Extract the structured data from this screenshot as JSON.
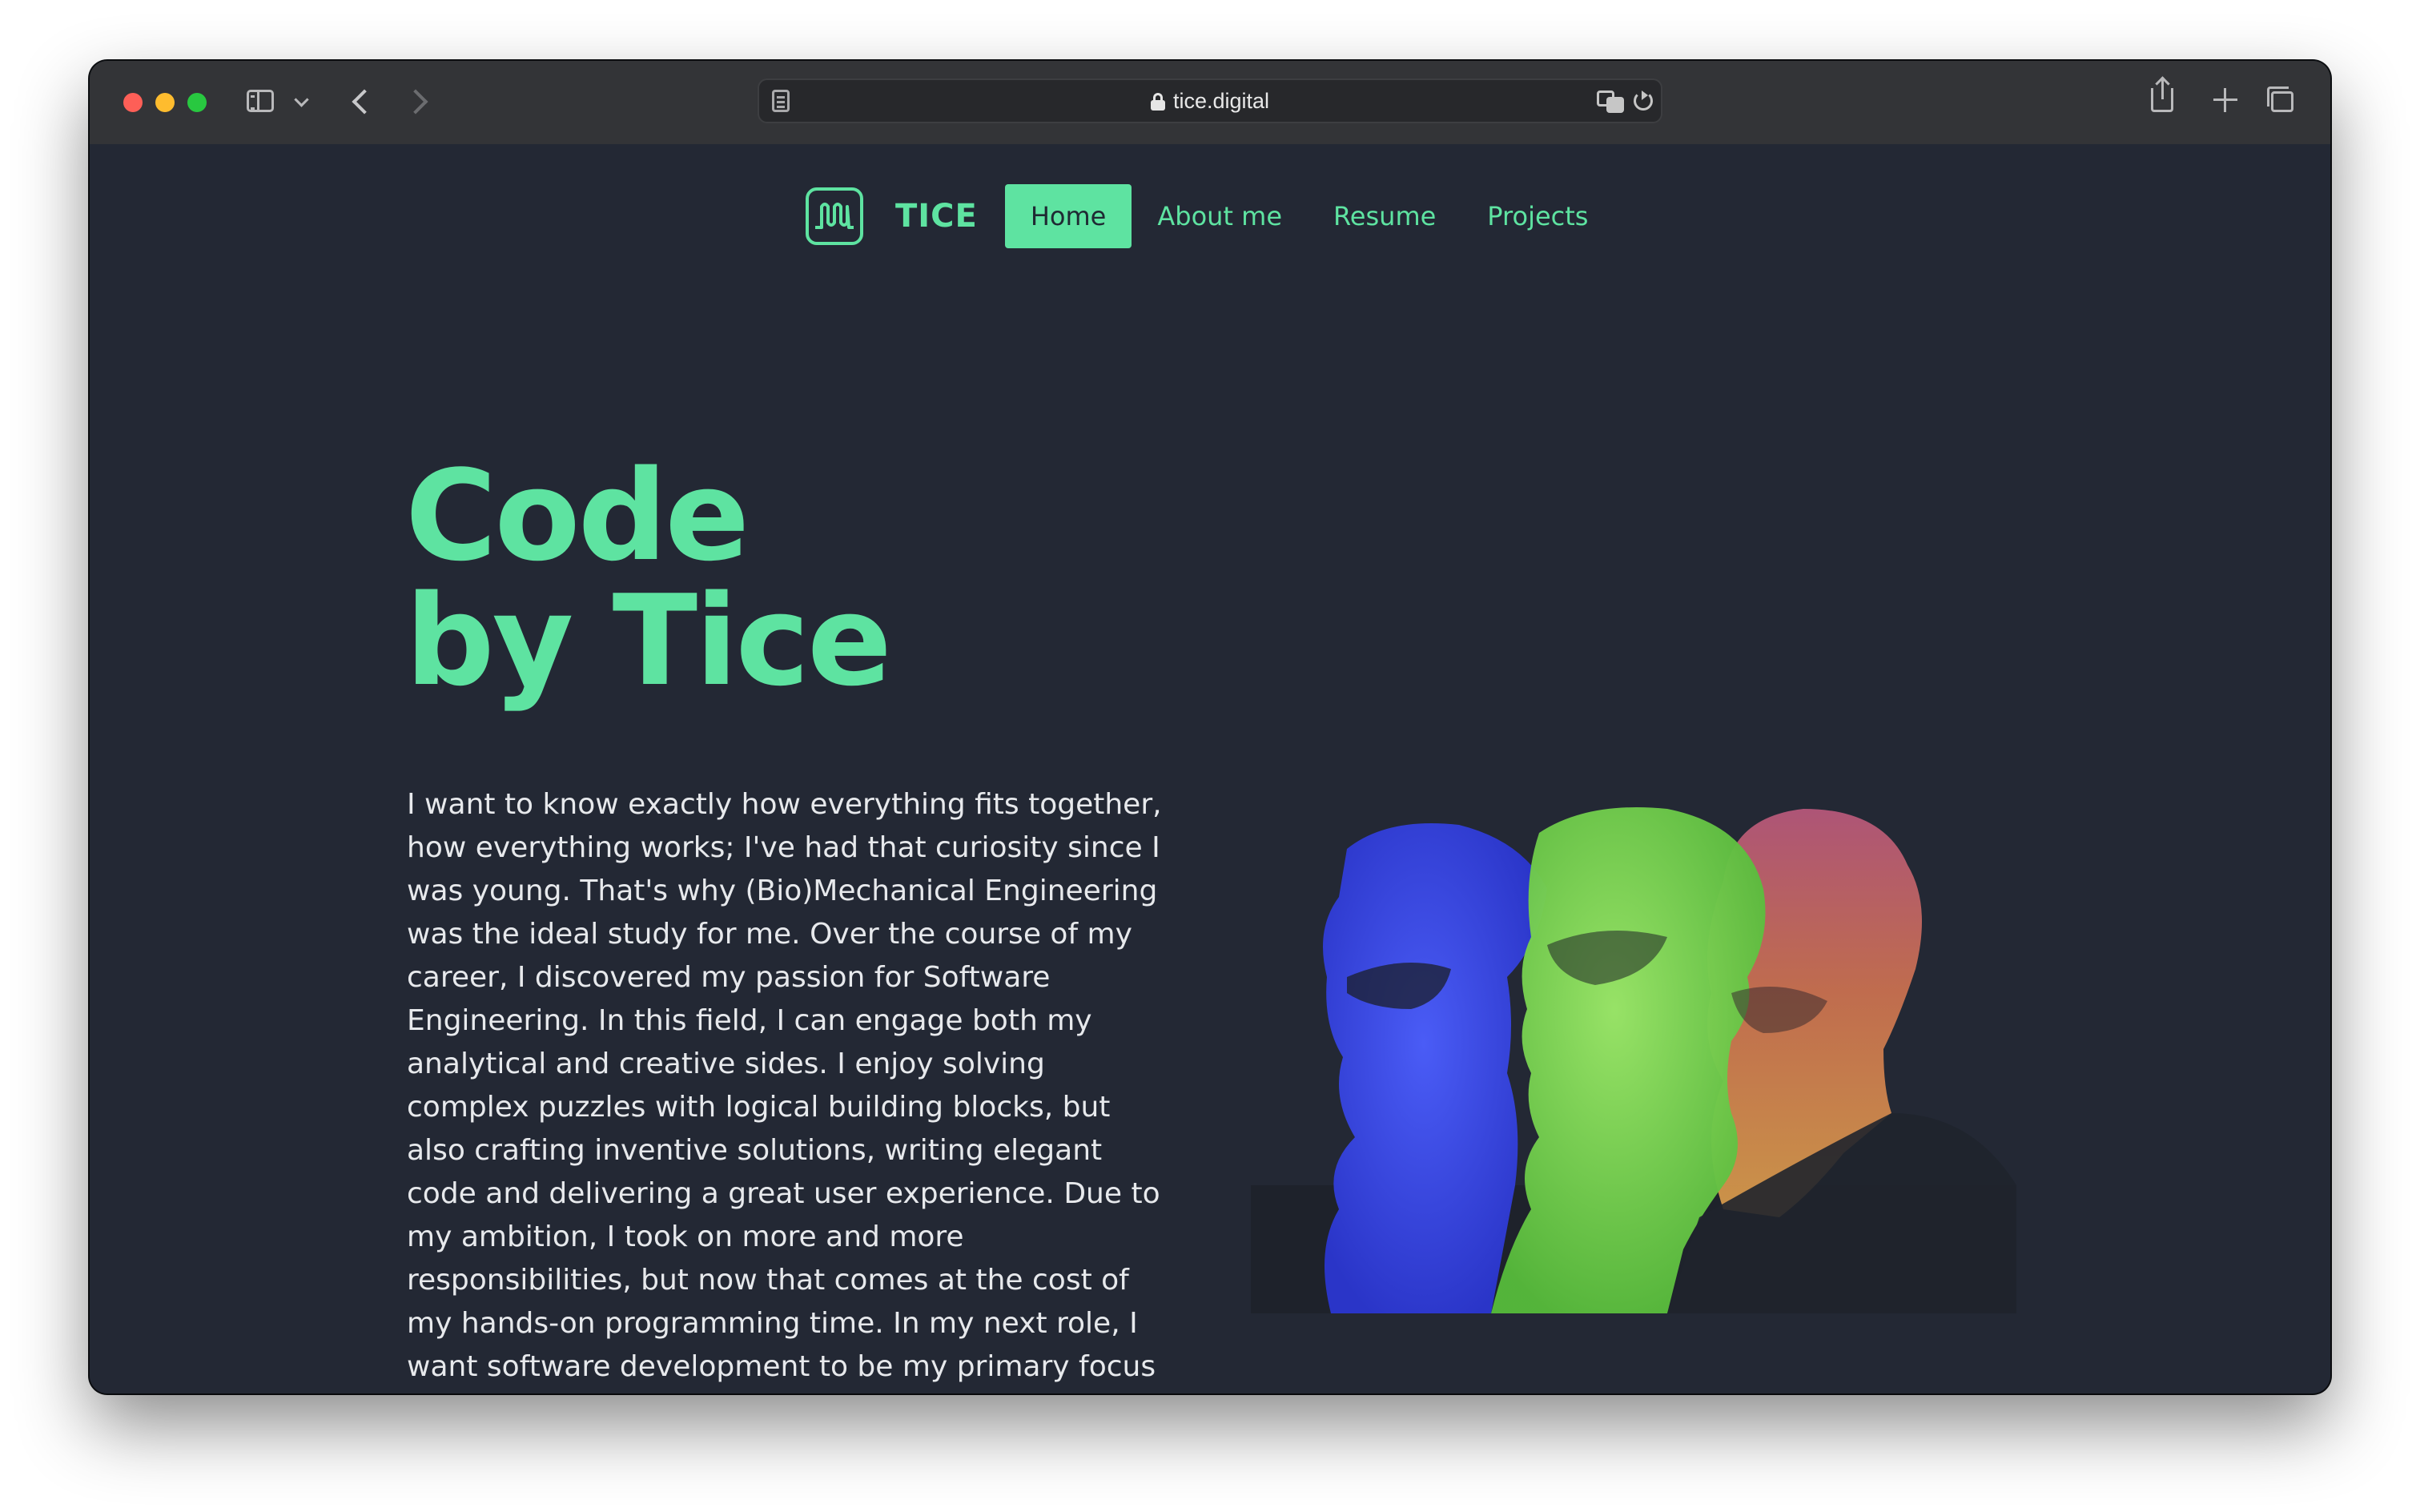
{
  "browser": {
    "url": "tice.digital",
    "icons": [
      "sidebar-icon",
      "chevron-down-icon",
      "back-icon",
      "forward-icon",
      "reader-icon",
      "lock-icon",
      "translate-icon",
      "reload-icon",
      "share-icon",
      "new-tab-icon",
      "tabs-overview-icon"
    ]
  },
  "nav": {
    "brand": "TICE",
    "items": [
      {
        "label": "Home",
        "active": true
      },
      {
        "label": "About me"
      },
      {
        "label": "Resume"
      },
      {
        "label": "Projects"
      }
    ]
  },
  "hero": {
    "title_line1": "Code",
    "title_line2": "by Tice",
    "body": "I want to know exactly how everything fits together, how everything works; I've had that curiosity since I was young. That's why (Bio)Mechanical Engineering was the ideal study for me. Over the course of my career, I discovered my passion for Software Engineering. In this field, I can engage both my analytical and creative sides. I enjoy solving complex puzzles with logical building blocks, but also crafting inventive solutions, writing elegant code and delivering a great user experience. Due to my ambition, I took on more and more responsibilities, but now that comes at the cost of my hands-on programming time. In my next role, I want software development to be my primary focus again, ideally in TypeScript within a Front-end or Full-stack role, while also taking on leadership responsibilities as"
  },
  "colors": {
    "accent": "#5ee3a1",
    "background": "#232834",
    "text": "#e7e9ec",
    "portrait_blue": "#3a4ff0",
    "portrait_green": "#7ad64e",
    "portrait_orange": "#d88a4e"
  }
}
